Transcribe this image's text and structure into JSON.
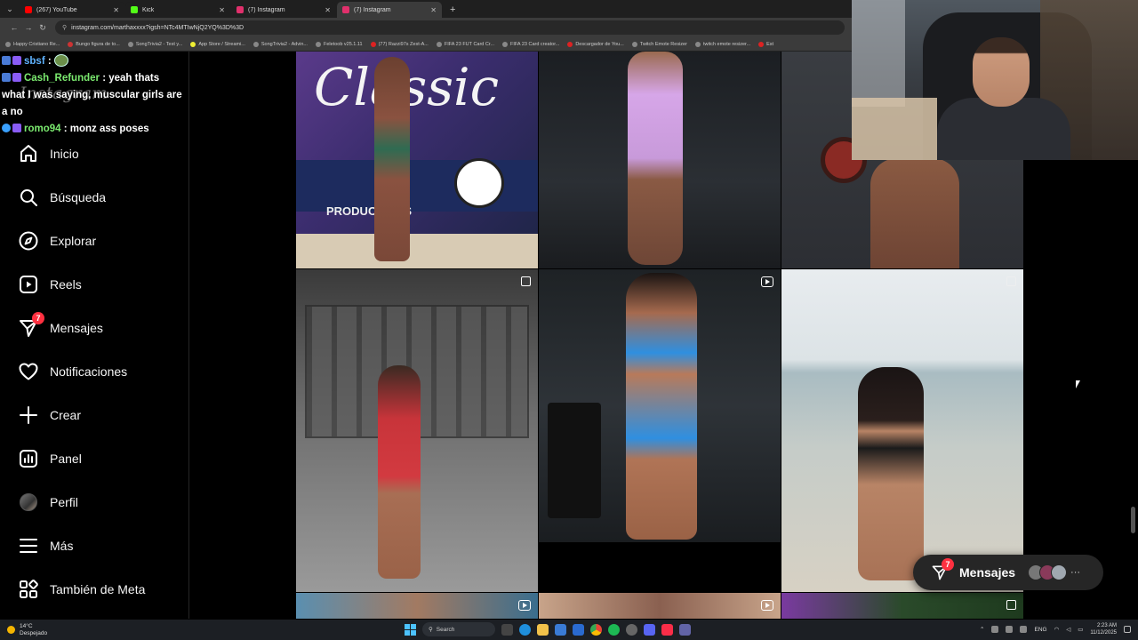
{
  "browser": {
    "tabs": [
      {
        "title": "(267) YouTube",
        "color": "#ff0000",
        "active": false
      },
      {
        "title": "Kick",
        "color": "#53fc18",
        "active": false
      },
      {
        "title": "(7) Instagram",
        "color": "#e1306c",
        "active": false
      },
      {
        "title": "(7) Instagram",
        "color": "#e1306c",
        "active": true
      }
    ],
    "url": "instagram.com/marthaxxxx?igsh=NTc4MTIwNjQ2YQ%3D%3D",
    "bookmarks": [
      "Happy Cristiano Re...",
      "Bungo figura de to...",
      "SongTrivia2 - Test y...",
      "App Store / Streami...",
      "SongTrivia2 - Advin...",
      "Feletoob v25.1.11",
      "(77) Razzi97s Zest-A...",
      "FIFA 23 FUT Card Cr...",
      "FIFA 23 Card creator...",
      "Descargador de You...",
      "Twitch Emote Resizer",
      "twitch emote resizer...",
      "Est"
    ]
  },
  "sidebar": {
    "logo": "Instagram",
    "items": [
      {
        "label": "Inicio",
        "icon": "home-icon"
      },
      {
        "label": "Búsqueda",
        "icon": "search-icon"
      },
      {
        "label": "Explorar",
        "icon": "compass-icon"
      },
      {
        "label": "Reels",
        "icon": "reels-icon"
      },
      {
        "label": "Mensajes",
        "icon": "messenger-icon",
        "badge": "7"
      },
      {
        "label": "Notificaciones",
        "icon": "heart-icon"
      },
      {
        "label": "Crear",
        "icon": "plus-icon"
      },
      {
        "label": "Panel",
        "icon": "chart-icon"
      },
      {
        "label": "Perfil",
        "icon": "avatar-icon"
      },
      {
        "label": "Más",
        "icon": "menu-icon"
      },
      {
        "label": "También de Meta",
        "icon": "meta-icon"
      }
    ]
  },
  "chat": {
    "messages": [
      {
        "user": "sbsf",
        "text": ":"
      },
      {
        "user": "Cash_Refunder",
        "text": ": yeah thats what I was saying, muscular girls are a no"
      },
      {
        "user": "romo94",
        "text": ": monz ass poses"
      }
    ]
  },
  "grid": {
    "tile_banner_text": "Classic",
    "tile_banner_sub": "PRODUCTIONS"
  },
  "floating_messages": {
    "label": "Mensajes",
    "badge": "7"
  },
  "taskbar": {
    "weather_temp": "14°C",
    "weather_desc": "Despejado",
    "search": "Search",
    "lang": "ENG",
    "time": "2:23 AM",
    "date": "11/12/2025"
  },
  "colors": {
    "badge": "#ff3040",
    "background": "#000000",
    "pill": "#262626"
  }
}
